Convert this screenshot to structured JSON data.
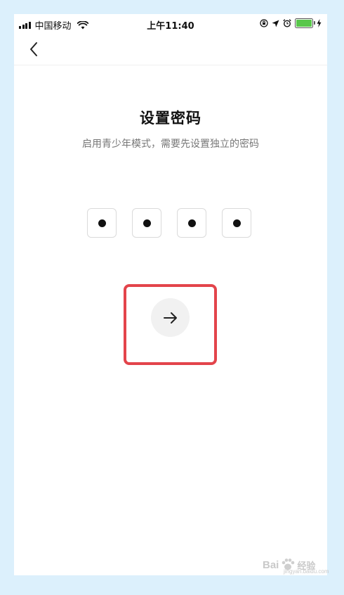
{
  "status_bar": {
    "carrier": "中国移动",
    "time": "上午11:40",
    "battery_level": 1.0,
    "icons": [
      "signal-icon",
      "wifi-icon",
      "rotation-lock-icon",
      "location-icon",
      "alarm-icon",
      "battery-icon",
      "charging-icon"
    ]
  },
  "nav": {
    "back_icon": "chevron-left-icon"
  },
  "main": {
    "title": "设置密码",
    "subtitle": "启用青少年模式，需要先设置独立的密码",
    "code_length": 4,
    "code_filled": 4,
    "next_icon": "arrow-right-icon"
  },
  "colors": {
    "background": "#dcf0fc",
    "highlight": "#e3444b",
    "battery": "#59c74b"
  },
  "watermark": {
    "brand": "Bai",
    "brand_suffix": "经验",
    "url": "jingyan.baidu.com"
  }
}
